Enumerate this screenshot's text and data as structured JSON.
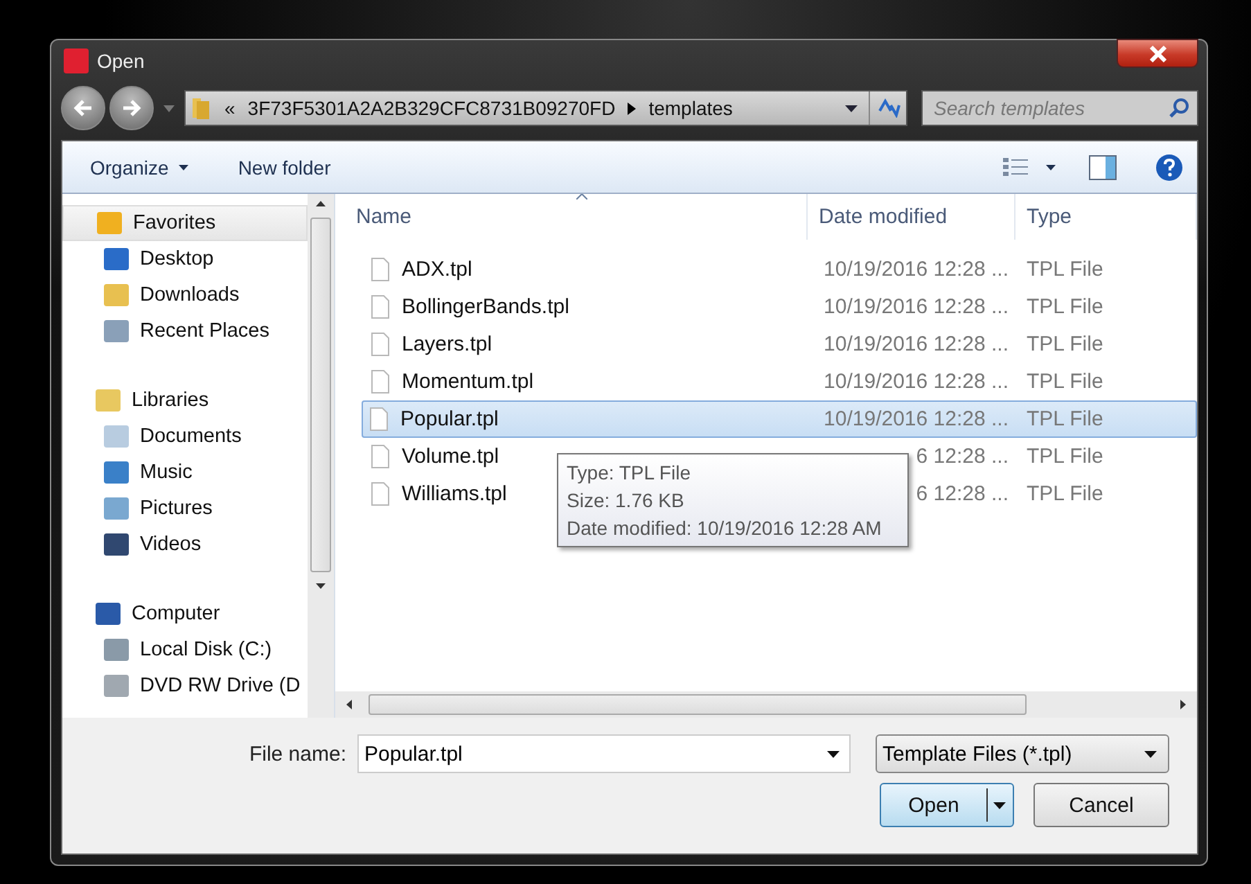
{
  "window": {
    "title": "Open"
  },
  "address": {
    "overflow": "«",
    "crumbs": [
      "3F73F5301A2A2B329CFC8731B09270FD",
      "templates"
    ]
  },
  "search": {
    "placeholder": "Search templates"
  },
  "toolbar": {
    "buttons": [
      {
        "label": "Organize",
        "dropdown": true
      },
      {
        "label": "New folder",
        "dropdown": false
      }
    ]
  },
  "sidebar": {
    "groups": [
      {
        "label": "Favorites",
        "selected": true,
        "children": [
          {
            "label": "Desktop",
            "selected": false
          },
          {
            "label": "Downloads",
            "selected": false
          },
          {
            "label": "Recent Places",
            "selected": false
          }
        ]
      },
      {
        "label": "Libraries",
        "selected": false,
        "children": [
          {
            "label": "Documents",
            "selected": false
          },
          {
            "label": "Music",
            "selected": false
          },
          {
            "label": "Pictures",
            "selected": false
          },
          {
            "label": "Videos",
            "selected": false
          }
        ]
      },
      {
        "label": "Computer",
        "selected": false,
        "children": [
          {
            "label": "Local Disk (C:)",
            "selected": false
          },
          {
            "label": "DVD RW Drive (D",
            "selected": false
          }
        ]
      }
    ]
  },
  "table": {
    "columns": [
      "Name",
      "Date modified",
      "Type"
    ],
    "rows": [
      {
        "name": "ADX.tpl",
        "date": "10/19/2016 12:28 ...",
        "type": "TPL File",
        "selected": false
      },
      {
        "name": "BollingerBands.tpl",
        "date": "10/19/2016 12:28 ...",
        "type": "TPL File",
        "selected": false
      },
      {
        "name": "Layers.tpl",
        "date": "10/19/2016 12:28 ...",
        "type": "TPL File",
        "selected": false
      },
      {
        "name": "Momentum.tpl",
        "date": "10/19/2016 12:28 ...",
        "type": "TPL File",
        "selected": false
      },
      {
        "name": "Popular.tpl",
        "date": "10/19/2016 12:28 ...",
        "type": "TPL File",
        "selected": true
      },
      {
        "name": "Volume.tpl",
        "date": "6 12:28 ...",
        "type": "TPL File",
        "selected": false
      },
      {
        "name": "Williams.tpl",
        "date": "6 12:28 ...",
        "type": "TPL File",
        "selected": false
      }
    ]
  },
  "tooltip": {
    "lines": [
      "Type: TPL File",
      "Size: 1.76 KB",
      "Date modified: 10/19/2016 12:28 AM"
    ]
  },
  "file_name": {
    "label": "File name:",
    "value": "Popular.tpl"
  },
  "file_type": {
    "value": "Template Files (*.tpl)"
  },
  "buttons": [
    {
      "label": "Open",
      "kind": "split",
      "default": true
    },
    {
      "label": "Cancel",
      "kind": "plain",
      "default": false
    }
  ]
}
